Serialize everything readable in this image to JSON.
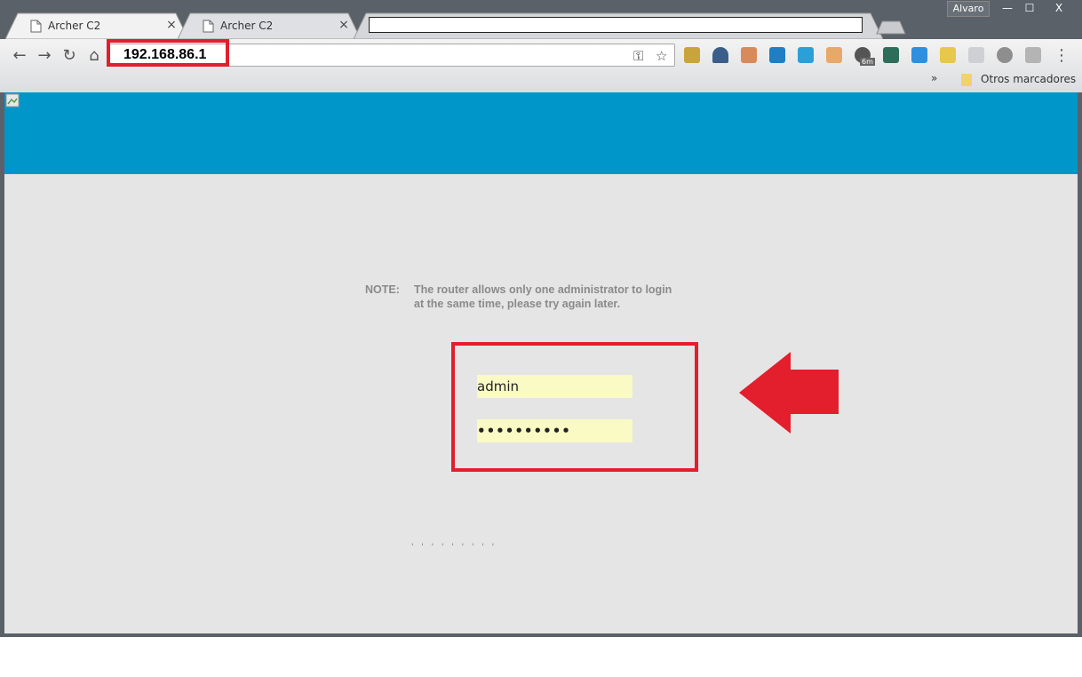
{
  "window": {
    "profile_name": "Alvaro",
    "minimize_label": "—",
    "maximize_label": "☐",
    "close_label": "X"
  },
  "tabs": [
    {
      "title": "Archer C2",
      "close": "×"
    },
    {
      "title": "Archer C2",
      "close": "×"
    }
  ],
  "toolbar": {
    "back": "←",
    "forward": "→",
    "reload": "↻",
    "home": "⌂",
    "url": "192.168.86.1",
    "key_icon": "⚿",
    "star_icon": "☆",
    "menu": "⋮",
    "ext_badge": "6m"
  },
  "bookmarks": {
    "overflow": "»",
    "folder_label": "Otros marcadores"
  },
  "page": {
    "note_label": "NOTE:",
    "note_line1": "The router allows only one administrator to login",
    "note_line2": "at the same time, please try again later.",
    "username_value": "admin",
    "password_value": "••••••••••",
    "faint_text": "' ' ' ' ' ' ' ' '"
  },
  "colors": {
    "banner": "#0096c9",
    "highlight": "#e31e2d",
    "field_bg": "#fafac4"
  }
}
